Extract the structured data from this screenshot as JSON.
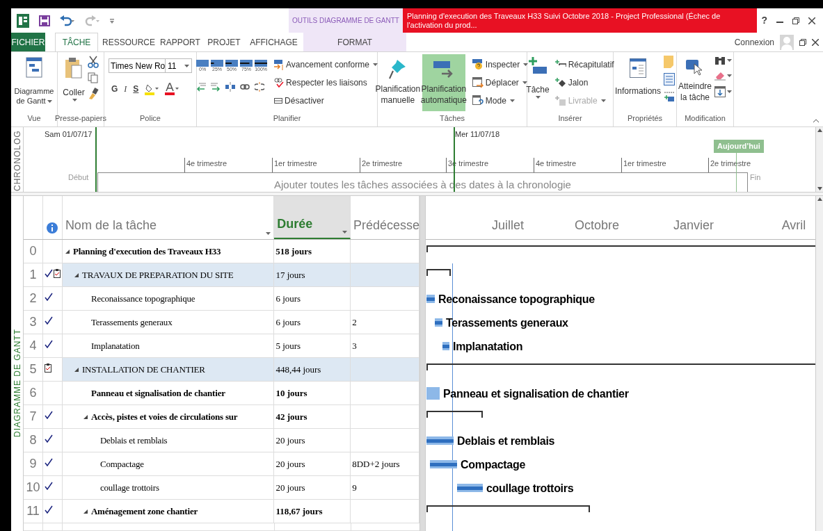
{
  "title_bar": {
    "context_group": "OUTILS DIAGRAMME DE GANTT",
    "title": "Planning d'execution des Traveaux H33 Suivi Octobre 2018 -  Project Professional (Échec de l'activation du prod...",
    "help": "?"
  },
  "ribbon_tabs": [
    {
      "label": "FICHIER",
      "kind": "file",
      "selected": false
    },
    {
      "label": "TÂCHE",
      "kind": "tab",
      "selected": true
    },
    {
      "label": "RESSOURCE",
      "kind": "tab",
      "selected": false
    },
    {
      "label": "RAPPORT",
      "kind": "tab",
      "selected": false
    },
    {
      "label": "PROJET",
      "kind": "tab",
      "selected": false
    },
    {
      "label": "AFFICHAGE",
      "kind": "tab",
      "selected": false
    },
    {
      "label": "FORMAT",
      "kind": "contextual",
      "selected": false
    }
  ],
  "account": {
    "label": "Connexion"
  },
  "ribbon": {
    "view": {
      "label": "Vue",
      "gantt_button": "Diagramme de Gantt"
    },
    "clipboard": {
      "label": "Presse-papiers",
      "paste": "Coller"
    },
    "font": {
      "label": "Police",
      "font_name": "Times New Ro",
      "font_size": "11",
      "bold": "G",
      "italic": "I",
      "underline": "S"
    },
    "schedule": {
      "label": "Planifier",
      "percent_buttons": [
        "0%",
        "25%",
        "50%",
        "75%",
        "100%"
      ],
      "commands": [
        "Avancement conforme",
        "Respecter les liaisons",
        "Désactiver"
      ]
    },
    "tasks": {
      "label": "Tâches",
      "modes": [
        {
          "label": "Planification manuelle",
          "selected": false
        },
        {
          "label": "Planification automatique",
          "selected": true
        }
      ],
      "commands": [
        "Inspecter",
        "Déplacer",
        "Mode"
      ]
    },
    "insert": {
      "label": "Insérer",
      "task": "Tâche",
      "commands": [
        {
          "label": "Récapitulatif",
          "disabled": false
        },
        {
          "label": "Jalon",
          "disabled": false
        },
        {
          "label": "Livrable",
          "disabled": true
        }
      ]
    },
    "properties": {
      "label": "Propriétés",
      "information": "Informations"
    },
    "editing": {
      "label": "Modification",
      "scroll_to_task": "Atteindre la tâche"
    }
  },
  "timeline": {
    "side_label": "CHRONOLOG",
    "start_date": "Sam 01/07/17",
    "start_label": "Début",
    "marker_date": "Mer 11/07/18",
    "today": "Aujourd’hui",
    "end_label": "Fin",
    "placeholder": "Ajouter toutes les tâches associées à des dates à la chronologie",
    "quarters": [
      "4e trimestre",
      "1er trimestre",
      "2e trimestre",
      "3e trimestre",
      "4e trimestre",
      "1er trimestre",
      "2e trimestre"
    ]
  },
  "gantt": {
    "side_label": "DIAGRAMME DE GANTT",
    "columns": [
      {
        "label": "Nom de la tâche",
        "selected": false
      },
      {
        "label": "Durée",
        "selected": true
      },
      {
        "label": "Prédécesse",
        "selected": false
      }
    ],
    "timescale": [
      "Juillet",
      "Octobre",
      "Janvier",
      "Avril"
    ],
    "rows": [
      {
        "id": "0",
        "name": "Planning d'execution des Traveaux H33",
        "duration": "518 jours",
        "completed": false,
        "note": false,
        "bold": true,
        "highlighted": false,
        "expanded": true,
        "children": [
          {
            "id": "1",
            "name": "TRAVAUX DE PREPARATION DU SITE",
            "duration": "17 jours",
            "completed": true,
            "note": true,
            "bold": false,
            "highlighted": true,
            "expanded": true,
            "children": [
              {
                "id": "2",
                "name": "Reconaissance topographique",
                "duration": "6 jours",
                "completed": true,
                "note": false,
                "bold": false,
                "highlighted": false,
                "bar_label": "Reconaissance topographique"
              },
              {
                "id": "3",
                "name": "Terassements generaux",
                "duration": "6 jours",
                "predecessors": "2",
                "completed": true,
                "note": false,
                "bold": false,
                "highlighted": false,
                "bar_label": "Terassements generaux"
              },
              {
                "id": "4",
                "name": "Implanatation",
                "duration": "5 jours",
                "predecessors": "3",
                "completed": true,
                "note": false,
                "bold": false,
                "highlighted": false,
                "bar_label": "Implanatation"
              }
            ]
          },
          {
            "id": "5",
            "name": "INSTALLATION DE CHANTIER",
            "duration": "448,44 jours",
            "completed": false,
            "note": true,
            "bold": false,
            "highlighted": true,
            "expanded": true,
            "children": [
              {
                "id": "6",
                "name": "Panneau et signalisation de chantier",
                "duration": "10 jours",
                "completed": false,
                "note": false,
                "bold": true,
                "highlighted": false,
                "bar_label": "Panneau et signalisation de chantier"
              },
              {
                "id": "7",
                "name": "Accès, pistes et voies de circulations sur",
                "duration": "42 jours",
                "completed": true,
                "note": false,
                "bold": true,
                "highlighted": false,
                "expanded": true,
                "children": [
                  {
                    "id": "8",
                    "name": "Deblais et remblais",
                    "duration": "20 jours",
                    "completed": true,
                    "note": false,
                    "bold": false,
                    "highlighted": false,
                    "bar_label": "Deblais et remblais"
                  },
                  {
                    "id": "9",
                    "name": "Compactage",
                    "duration": "20 jours",
                    "predecessors": "8DD+2 jours",
                    "completed": true,
                    "note": false,
                    "bold": false,
                    "highlighted": false,
                    "bar_label": "Compactage"
                  },
                  {
                    "id": "10",
                    "name": "coullage trottoirs",
                    "duration": "20 jours",
                    "predecessors": "9",
                    "completed": true,
                    "note": false,
                    "bold": false,
                    "highlighted": false,
                    "bar_label": "coullage trottoirs"
                  }
                ]
              },
              {
                "id": "11",
                "name": "Aménagement zone chantier",
                "duration": "118,67 jours",
                "completed": true,
                "note": false,
                "bold": true,
                "highlighted": false,
                "expanded": true
              }
            ]
          }
        ]
      }
    ]
  }
}
